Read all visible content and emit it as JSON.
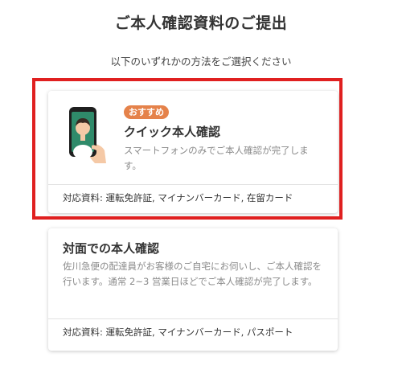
{
  "page": {
    "title": "ご本人確認資料のご提出",
    "subtitle": "以下のいずれかの方法をご選択ください"
  },
  "options": [
    {
      "badge": "おすすめ",
      "title": "クイック本人確認",
      "description": "スマートフォンのみでご本人確認が完了します。",
      "documents": "対応資料: 運転免許証, マイナンバーカード, 在留カード",
      "icon": "smartphone-selfie-icon"
    },
    {
      "title": "対面での本人確認",
      "description": "佐川急便の配達員がお客様のご自宅にお伺いし、ご本人確認を行います。通常 2~3 営業日ほどでご本人確認が完了します。",
      "documents": "対応資料: 運転免許証, マイナンバーカード, パスポート"
    }
  ],
  "colors": {
    "badge": "#e5824a",
    "highlight_border": "#e02020",
    "phone_screen": "#2f8a6a"
  }
}
